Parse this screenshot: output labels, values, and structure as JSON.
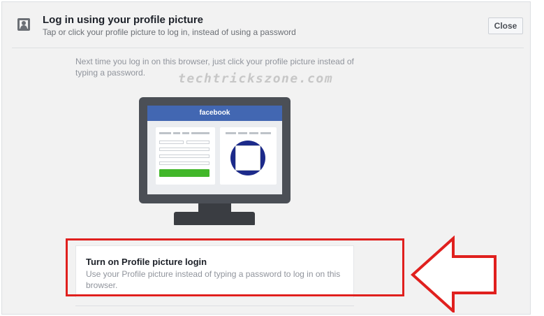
{
  "header": {
    "title": "Log in using your profile picture",
    "subtitle": "Tap or click your profile picture to log in, instead of using a password",
    "close_label": "Close"
  },
  "description": "Next time you log in on this browser, just click your profile picture instead of typing a password.",
  "watermark": "techtrickszone.com",
  "illustration": {
    "brand": "facebook"
  },
  "cta": {
    "title": "Turn on Profile picture login",
    "description": "Use your Profile picture instead of typing a password to log in on this browser."
  },
  "colors": {
    "brand_blue": "#4267b2",
    "green": "#42b72a",
    "highlight_red": "#e0201e"
  }
}
